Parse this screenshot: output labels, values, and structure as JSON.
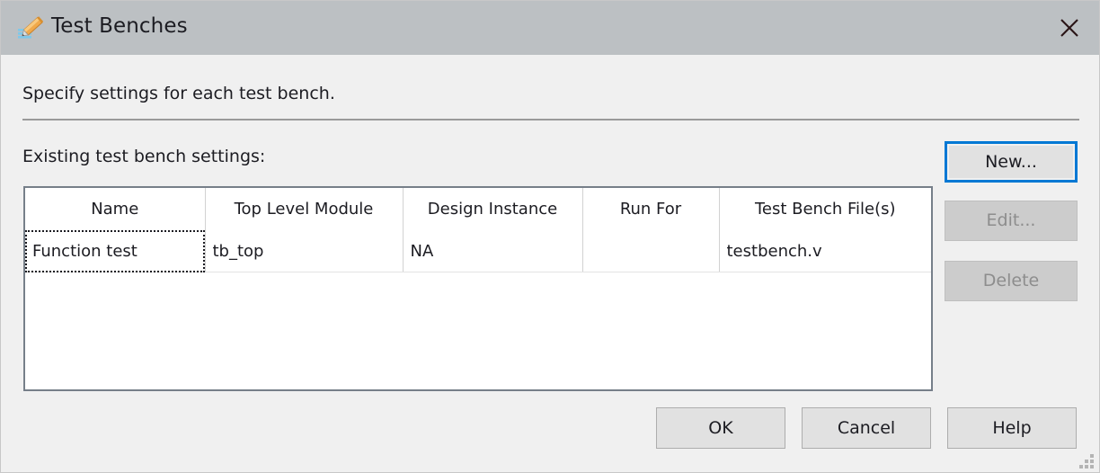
{
  "window": {
    "title": "Test Benches",
    "icon": "testbench-pencil-icon",
    "close_label": "✕",
    "titlebar_color": "#bcc0c3",
    "body_color": "#f0f0f0"
  },
  "body": {
    "instruction": "Specify settings for each test bench.",
    "list_label": "Existing test bench settings:"
  },
  "table": {
    "columns": [
      "Name",
      "Top Level Module",
      "Design Instance",
      "Run For",
      "Test Bench File(s)"
    ],
    "rows": [
      {
        "name": "Function test",
        "top_level_module": "tb_top",
        "design_instance": "NA",
        "run_for": "",
        "test_bench_files": "testbench.v"
      }
    ]
  },
  "side_buttons": {
    "new": {
      "label": "New...",
      "enabled": true,
      "focused": true,
      "focus_color": "#0078d4"
    },
    "edit": {
      "label": "Edit...",
      "enabled": false,
      "focused": false
    },
    "delete": {
      "label": "Delete",
      "enabled": false,
      "focused": false
    }
  },
  "footer_buttons": {
    "ok": {
      "label": "OK",
      "enabled": true
    },
    "cancel": {
      "label": "Cancel",
      "enabled": true
    },
    "help": {
      "label": "Help",
      "enabled": true
    }
  },
  "resize_grip": {
    "icon": "resize-grip-icon"
  }
}
